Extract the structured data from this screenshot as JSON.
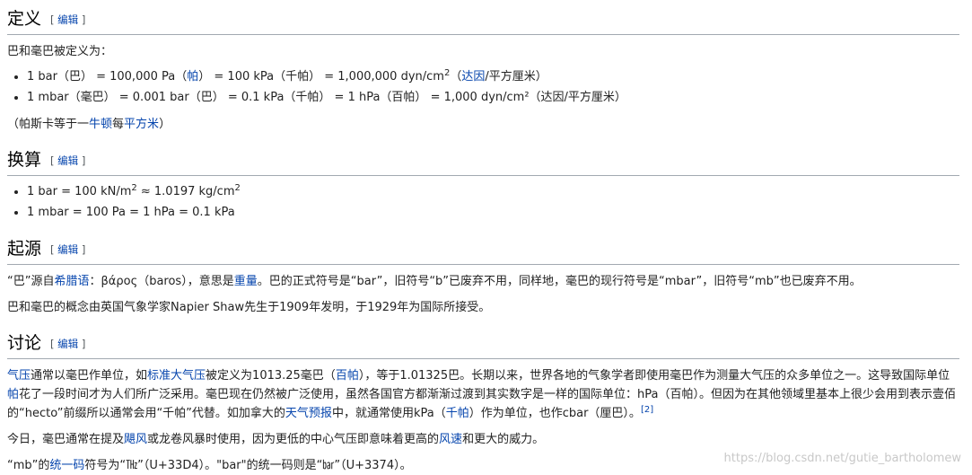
{
  "edit_label": "编辑",
  "definition": {
    "heading": "定义",
    "intro": "巴和毫巴被定义为：",
    "item1": {
      "a": "1 bar（巴） = 100,000 Pa（",
      "link1": "帕",
      "b": "） = 100 kPa（千帕） = 1,000,000 dyn/cm",
      "sup": "2",
      "c": "（",
      "link2": "达因",
      "d": "/平方厘米）"
    },
    "item2": "1 mbar（毫巴） = 0.001 bar（巴） = 0.1 kPa（千帕） = 1 hPa（百帕） = 1,000 dyn/cm²（达因/平方厘米）",
    "note": {
      "a": "（帕斯卡等于一",
      "link1": "牛顿",
      "b": "每",
      "link2": "平方米",
      "c": "）"
    }
  },
  "conversion": {
    "heading": "换算",
    "item1": {
      "a": "1 bar = 100 kN/m",
      "sup1": "2",
      "b": " ≈ 1.0197 kg/cm",
      "sup2": "2"
    },
    "item2": "1 mbar = 100 Pa = 1 hPa = 0.1 kPa"
  },
  "origin": {
    "heading": "起源",
    "p1": {
      "a": "“巴”源自",
      "link1": "希腊语",
      "b": "：βάρος（baros），意思是",
      "link2": "重量",
      "c": "。巴的正式符号是“bar”，旧符号“b”已废弃不用，同样地，毫巴的现行符号是“mbar”，旧符号“mb”也已废弃不用。"
    },
    "p2": "巴和毫巴的概念由英国气象学家Napier Shaw先生于1909年发明，于1929年为国际所接受。"
  },
  "discussion": {
    "heading": "讨论",
    "p1": {
      "link1": "气压",
      "a": "通常以毫巴作单位，如",
      "link2": "标准大气压",
      "b": "被定义为1013.25毫巴（",
      "link3": "百帕",
      "c": "），等于1.01325巴。长期以来，世界各地的气象学者即使用毫巴作为测量大气压的众多单位之一。这导致国际单位",
      "link4": "帕",
      "d": "花了一段时间才为人们所广泛采用。毫巴现在仍然被广泛使用，虽然各国官方都渐渐过渡到其实数字是一样的国际单位：hPa（百帕）。但因为在其他领域里基本上很少会用到表示壹佰的“hecto”前缀所以通常会用“千帕”代替。如加拿大的",
      "link5": "天气预报",
      "e": "中，就通常使用kPa（",
      "link6": "千帕",
      "f": "）作为单位，也作cbar（厘巴）。",
      "ref": "[2]"
    },
    "p2": {
      "a": "今日，毫巴通常在提及",
      "link1": "飓风",
      "b": "或龙卷风暴时使用，因为更低的中心气压即意味着更高的",
      "link2": "风速",
      "c": "和更大的威力。"
    },
    "p3": {
      "a": "“mb”的",
      "link1": "统一码",
      "b": "符号为“㎔”（U+33D4）。\"bar\"的统一码则是“㍴”（U+3374）。"
    }
  },
  "watermark": "https://blog.csdn.net/gutie_bartholomew"
}
